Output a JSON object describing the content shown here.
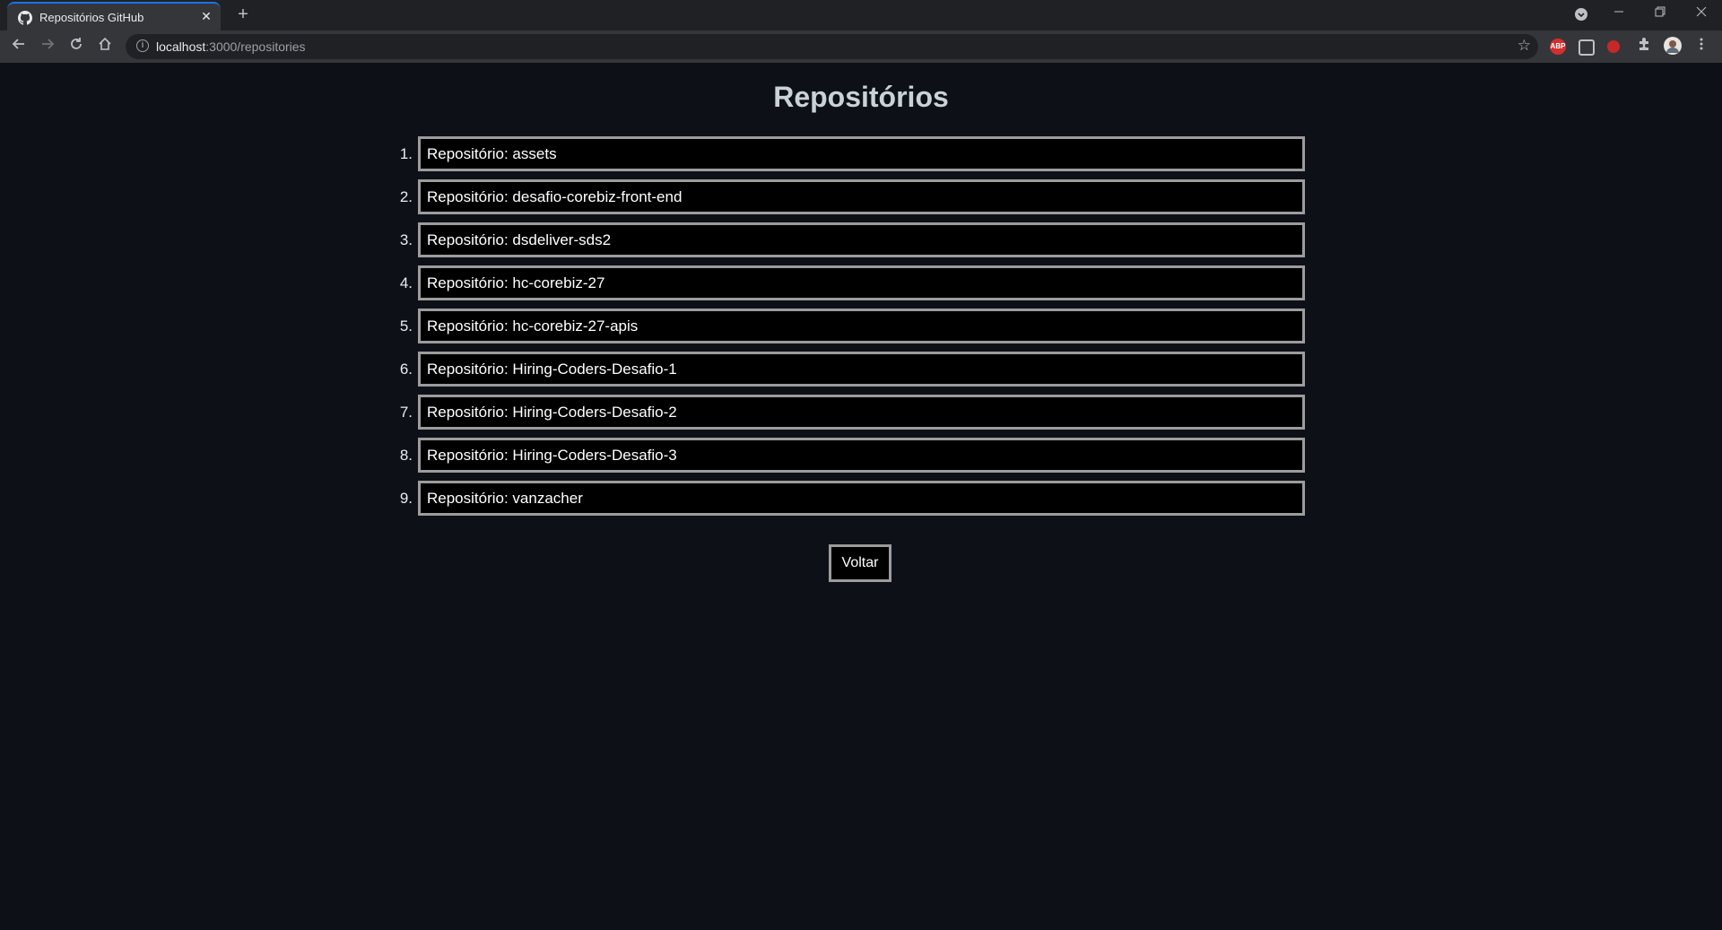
{
  "browser": {
    "tab": {
      "title": "Repositórios GitHub",
      "close_glyph": "✕",
      "icon": "github-icon"
    },
    "new_tab_glyph": "+",
    "address": {
      "host": "localhost",
      "path": ":3000/repositories"
    },
    "extensions": [
      {
        "name": "adblock-icon",
        "text": "ABP",
        "color": "#d32f2f"
      },
      {
        "name": "extension-square-icon",
        "text": "",
        "color": "#5f6368"
      },
      {
        "name": "extension-red-icon",
        "text": "",
        "color": "#c62828"
      }
    ]
  },
  "page": {
    "heading": "Repositórios",
    "repositories": [
      {
        "number": "1.",
        "label": "Repositório: assets"
      },
      {
        "number": "2.",
        "label": "Repositório: desafio-corebiz-front-end"
      },
      {
        "number": "3.",
        "label": "Repositório: dsdeliver-sds2"
      },
      {
        "number": "4.",
        "label": "Repositório: hc-corebiz-27"
      },
      {
        "number": "5.",
        "label": "Repositório: hc-corebiz-27-apis"
      },
      {
        "number": "6.",
        "label": "Repositório: Hiring-Coders-Desafio-1"
      },
      {
        "number": "7.",
        "label": "Repositório: Hiring-Coders-Desafio-2"
      },
      {
        "number": "8.",
        "label": "Repositório: Hiring-Coders-Desafio-3"
      },
      {
        "number": "9.",
        "label": "Repositório: vanzacher"
      }
    ],
    "back_button": "Voltar"
  },
  "colors": {
    "background": "#0d1117",
    "heading": "#c9d1d9",
    "box_border": "#9c9c9c"
  }
}
